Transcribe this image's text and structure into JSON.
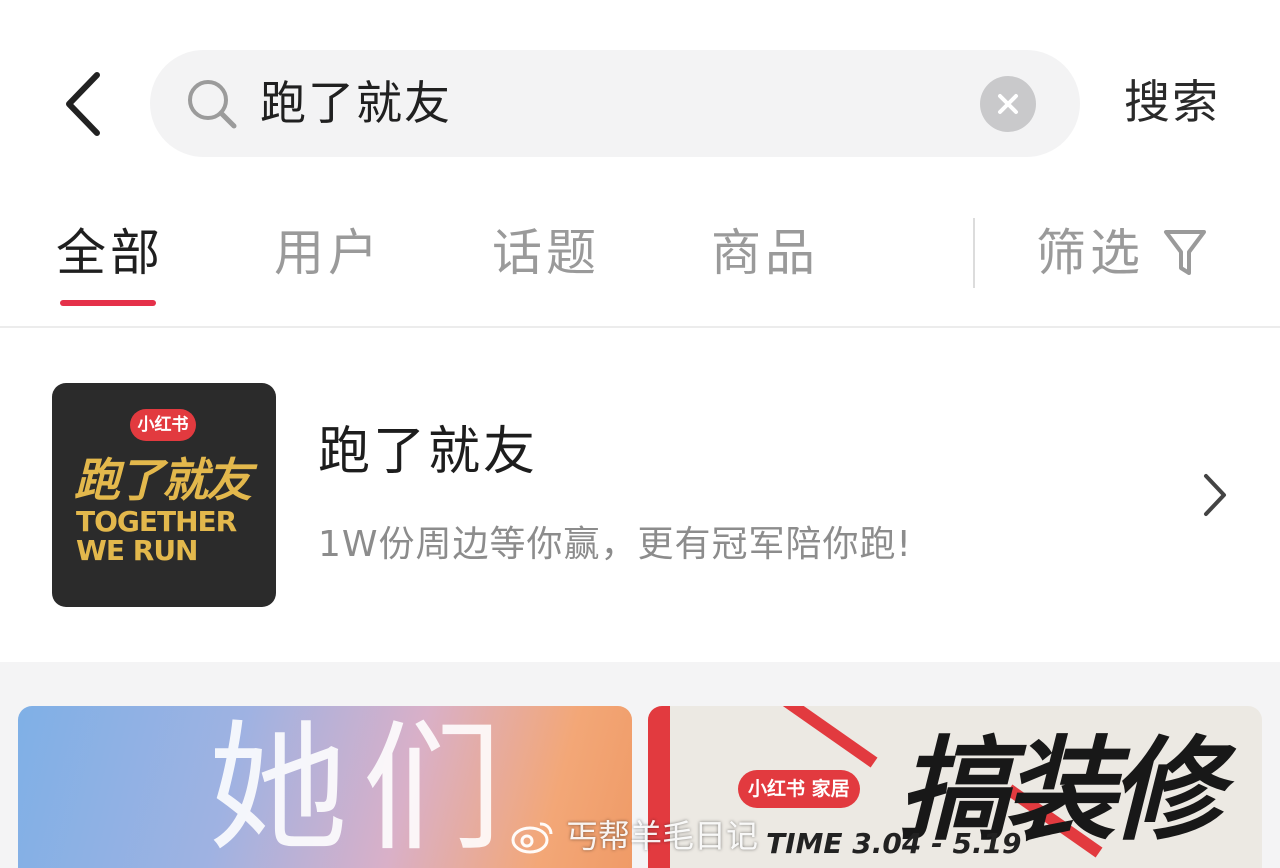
{
  "search": {
    "query": "跑了就友",
    "submit_label": "搜索"
  },
  "tabs": [
    {
      "label": "全部",
      "active": true
    },
    {
      "label": "用户",
      "active": false
    },
    {
      "label": "话题",
      "active": false
    },
    {
      "label": "商品",
      "active": false
    }
  ],
  "filter": {
    "label": "筛选"
  },
  "topic": {
    "title": "跑了就友",
    "description": "1W份周边等你赢，更有冠军陪你跑!",
    "cover": {
      "badge": "小红书",
      "title": "跑了就友",
      "subtitle_line1": "TOGETHER",
      "subtitle_line2": "WE RUN"
    }
  },
  "feed": {
    "card1": {
      "text": "她们"
    },
    "card2": {
      "badge": "小红书 家居",
      "headline": "搞装修",
      "date": "TIME 3.04 - 5.19"
    }
  },
  "watermark": {
    "text": "丐帮羊毛日记"
  },
  "colors": {
    "accent": "#e5314a",
    "cover_bg": "#2b2b2b",
    "cover_gold": "#e3b84c"
  }
}
